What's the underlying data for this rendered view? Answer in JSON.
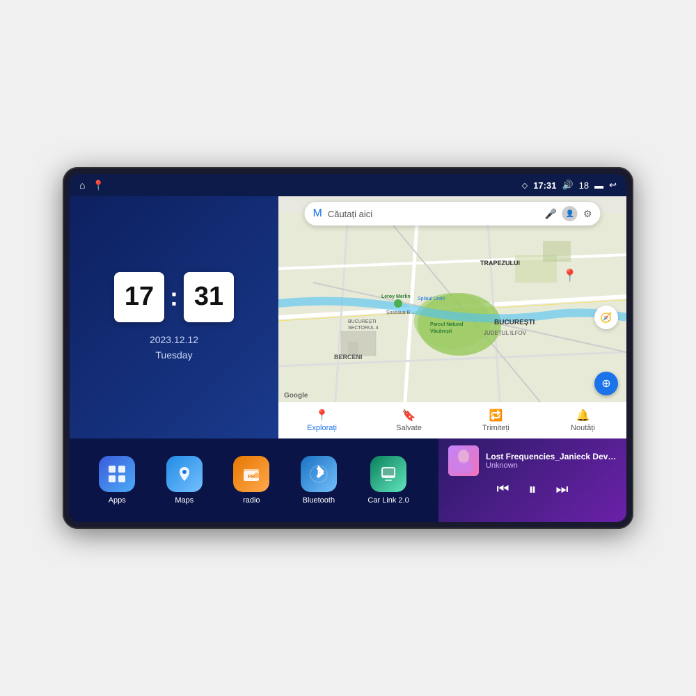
{
  "device": {
    "status_bar": {
      "left_icons": [
        "home-icon",
        "location-icon"
      ],
      "right_items": {
        "gps_icon": "◇",
        "time": "17:31",
        "volume_icon": "🔊",
        "volume_level": "18",
        "battery_icon": "🔋",
        "back_icon": "↩"
      }
    },
    "clock": {
      "hours": "17",
      "minutes": "31",
      "date": "2023.12.12",
      "day": "Tuesday"
    },
    "map": {
      "search_placeholder": "Căutați aici",
      "labels": {
        "parcul": "Parcul Natural Văcărești",
        "leroy": "Leroy Merlin",
        "berceni": "BERCENI",
        "bucuresti": "BUCUREȘTI",
        "ilfov": "JUDEȚUL ILFOV",
        "trapezului": "TRAPEZULUI",
        "splaiul": "Splaiul Unirii",
        "sector4": "BUCUREȘTI SECTORUL 4",
        "sosea": "Șoseaua B..."
      },
      "nav_items": [
        {
          "label": "Explorați",
          "icon": "📍",
          "active": true
        },
        {
          "label": "Salvate",
          "icon": "🔖",
          "active": false
        },
        {
          "label": "Trimiteți",
          "icon": "🔁",
          "active": false
        },
        {
          "label": "Noutăți",
          "icon": "🔔",
          "active": false
        }
      ]
    },
    "apps": [
      {
        "id": "apps",
        "label": "Apps",
        "icon": "⊞",
        "color_class": "apps-icon"
      },
      {
        "id": "maps",
        "label": "Maps",
        "icon": "🗺",
        "color_class": "maps-icon"
      },
      {
        "id": "radio",
        "label": "radio",
        "icon": "📻",
        "color_class": "radio-icon"
      },
      {
        "id": "bluetooth",
        "label": "Bluetooth",
        "icon": "⚡",
        "color_class": "bluetooth-icon"
      },
      {
        "id": "carlink",
        "label": "Car Link 2.0",
        "icon": "📱",
        "color_class": "carlink-icon"
      }
    ],
    "music": {
      "title": "Lost Frequencies_Janieck Devy-...",
      "artist": "Unknown",
      "controls": {
        "prev": "⏮",
        "play": "⏸",
        "next": "⏭"
      }
    }
  }
}
